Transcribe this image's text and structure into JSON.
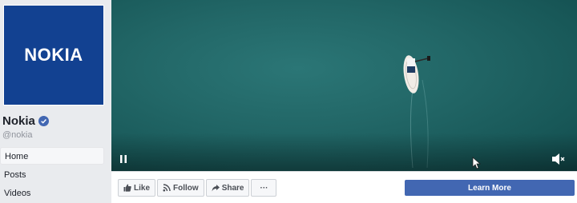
{
  "page": {
    "logo_text": "NOKIA",
    "name": "Nokia",
    "handle": "@nokia",
    "brand_color": "#124191"
  },
  "nav": {
    "items": [
      {
        "label": "Home",
        "active": true
      },
      {
        "label": "Posts",
        "active": false
      },
      {
        "label": "Videos",
        "active": false
      }
    ]
  },
  "video": {
    "controls": {
      "pause_icon": "pause-icon",
      "volume_icon": "volume-muted-icon"
    }
  },
  "actions": {
    "like_label": "Like",
    "follow_label": "Follow",
    "share_label": "Share",
    "more_label": "···",
    "cta_label": "Learn More",
    "cta_color": "#4267b2"
  }
}
